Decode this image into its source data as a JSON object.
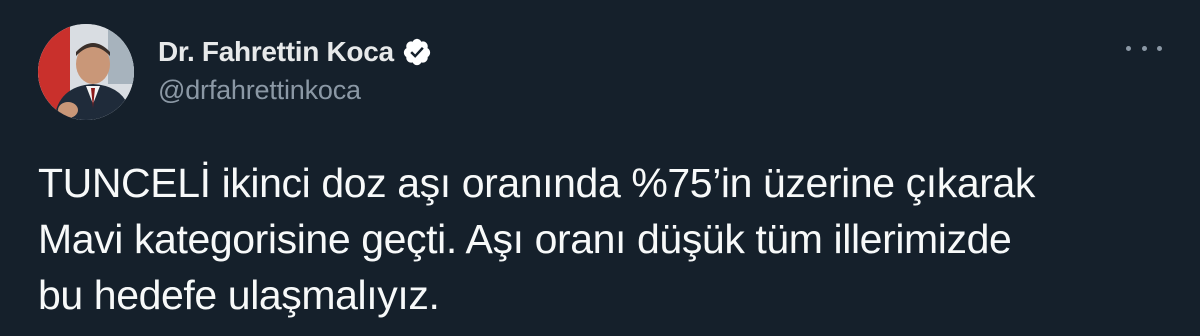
{
  "tweet": {
    "author": {
      "display_name": "Dr. Fahrettin Koca",
      "handle": "@drfahrettinkoca",
      "verified": true
    },
    "text_lines": [
      "TUNCELİ ikinci doz aşı oranında %75’in üzerine çıkarak",
      "Mavi kategorisine geçti. Aşı oranı düşük tüm illerimizde",
      "bu hedefe ulaşmalıyız."
    ],
    "more_icon": "more-horizontal-icon"
  },
  "colors": {
    "background": "#15202b",
    "name": "#e7e9ea",
    "secondary": "#8b98a5",
    "text": "#f7f9f9",
    "verified_badge": "#ffffff"
  }
}
